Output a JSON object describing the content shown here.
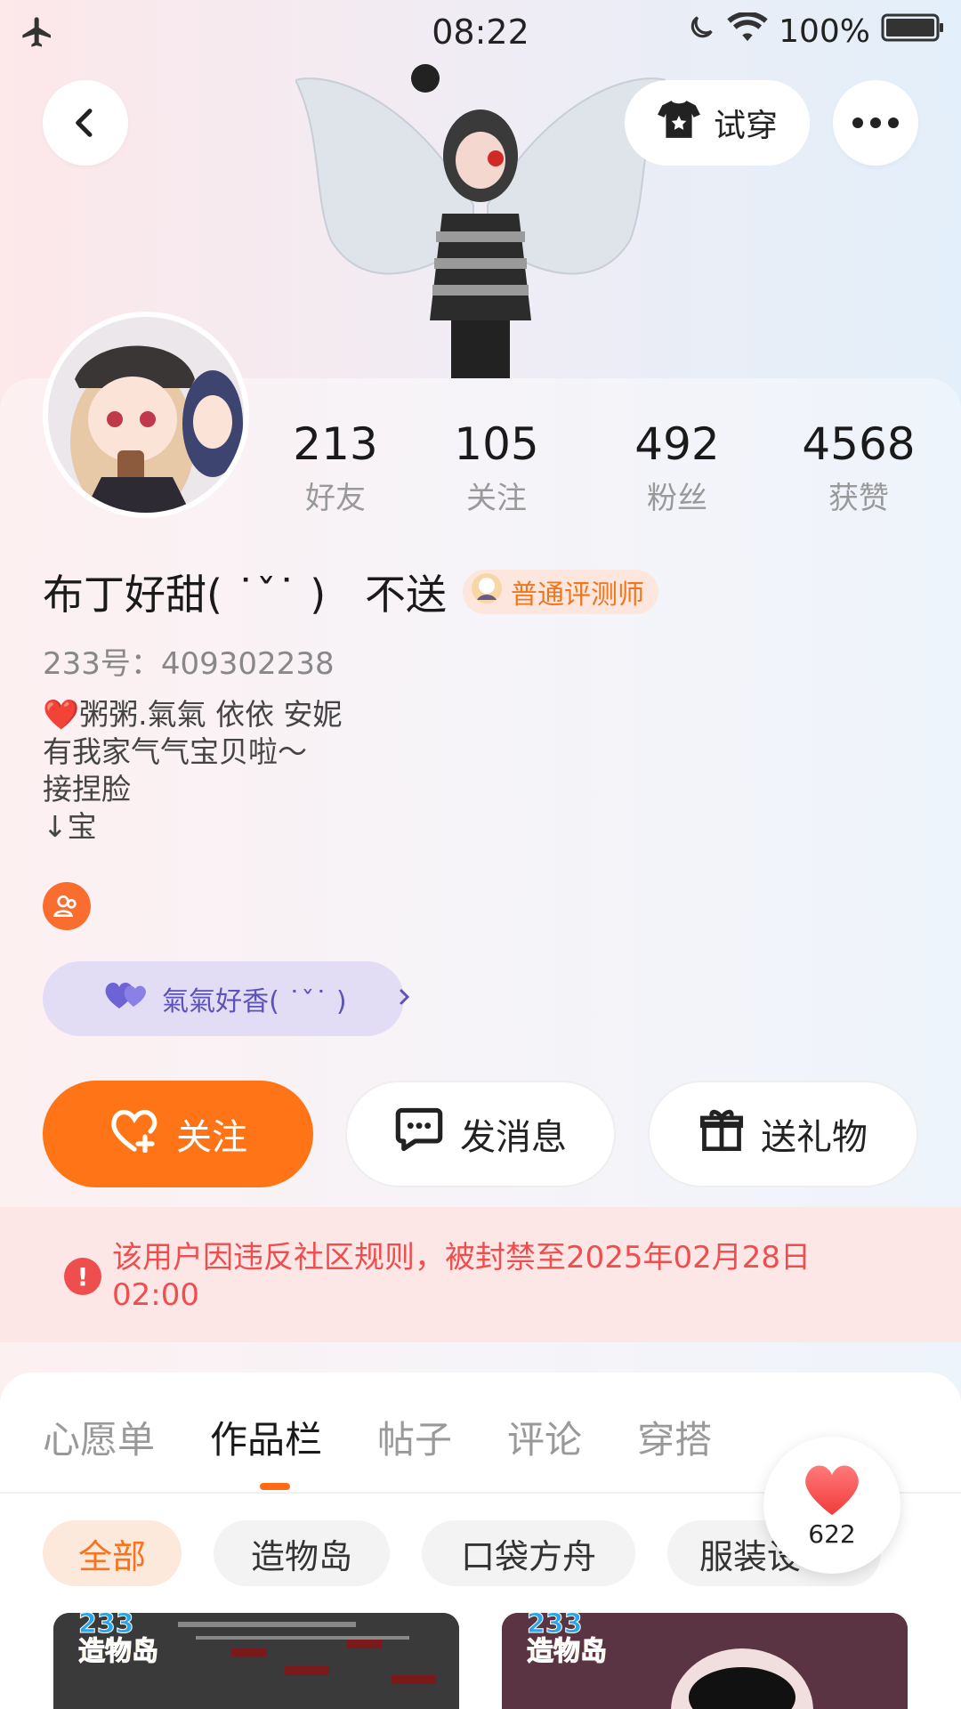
{
  "status_bar": {
    "time": "08:22",
    "battery": "100%"
  },
  "header": {
    "try_on_label": "试穿"
  },
  "stats": [
    {
      "value": "213",
      "label": "好友"
    },
    {
      "value": "105",
      "label": "关注"
    },
    {
      "value": "492",
      "label": "粉丝"
    },
    {
      "value": "4568",
      "label": "获赞"
    }
  ],
  "profile": {
    "name": "布丁好甜( ˙ˇ˙ )   不送",
    "badge": "普通评测师",
    "uid": "233号：409302238",
    "bio_lines": [
      "❤️粥粥.氣氣 依依 安妮",
      "有我家气气宝贝啦～",
      "接捏脸",
      "↓宝"
    ]
  },
  "cp": {
    "label": "氣氣好香( ˙ˇ˙ )"
  },
  "actions": {
    "follow": "关注",
    "message": "发消息",
    "gift": "送礼物"
  },
  "ban_notice": "该用户因违反社区规则，被封禁至2025年02月28日 02:00",
  "tabs": [
    "心愿单",
    "作品栏",
    "帖子",
    "评论",
    "穿搭"
  ],
  "active_tab": "作品栏",
  "filters": [
    "全部",
    "造物岛",
    "口袋方舟",
    "服装设"
  ],
  "like_count": "622",
  "game_logo_top": "233",
  "game_logo_bottom": "造物岛",
  "colors": {
    "accent": "#ff7416",
    "ban": "#ef4e4e",
    "cp": "#5d52b8"
  }
}
